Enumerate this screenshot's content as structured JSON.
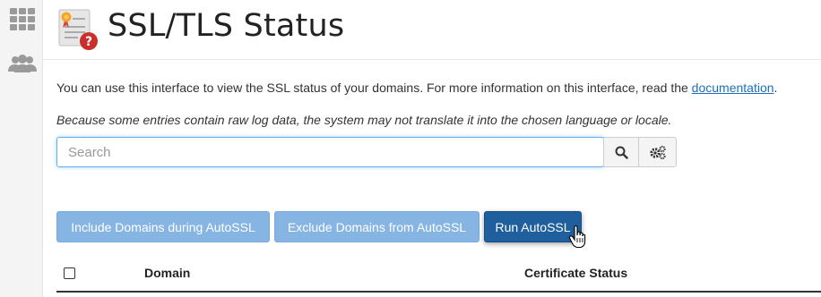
{
  "sidebar": {
    "items": [
      {
        "icon": "apps-grid-icon"
      },
      {
        "icon": "users-icon"
      }
    ]
  },
  "header": {
    "title": "SSL/TLS Status",
    "icon": "certificate-warning-icon"
  },
  "info": {
    "text": "You can use this interface to view the SSL status of your domains. For more information on this interface, read the ",
    "link_label": "documentation",
    "suffix": "."
  },
  "note": "Because some entries contain raw log data, the system may not translate it into the chosen language or locale.",
  "search": {
    "placeholder": "Search",
    "value": "",
    "search_icon": "search-icon",
    "settings_icon": "cogs-icon"
  },
  "actions": {
    "include_label": "Include Domains during AutoSSL",
    "exclude_label": "Exclude Domains from AutoSSL",
    "run_label": "Run AutoSSL"
  },
  "table": {
    "columns": [
      "Domain",
      "Certificate Status"
    ]
  },
  "colors": {
    "primary": "#1f5f9e",
    "primary_light": "#86b5e3",
    "link": "#1b6fba",
    "focus": "#66afe9"
  }
}
